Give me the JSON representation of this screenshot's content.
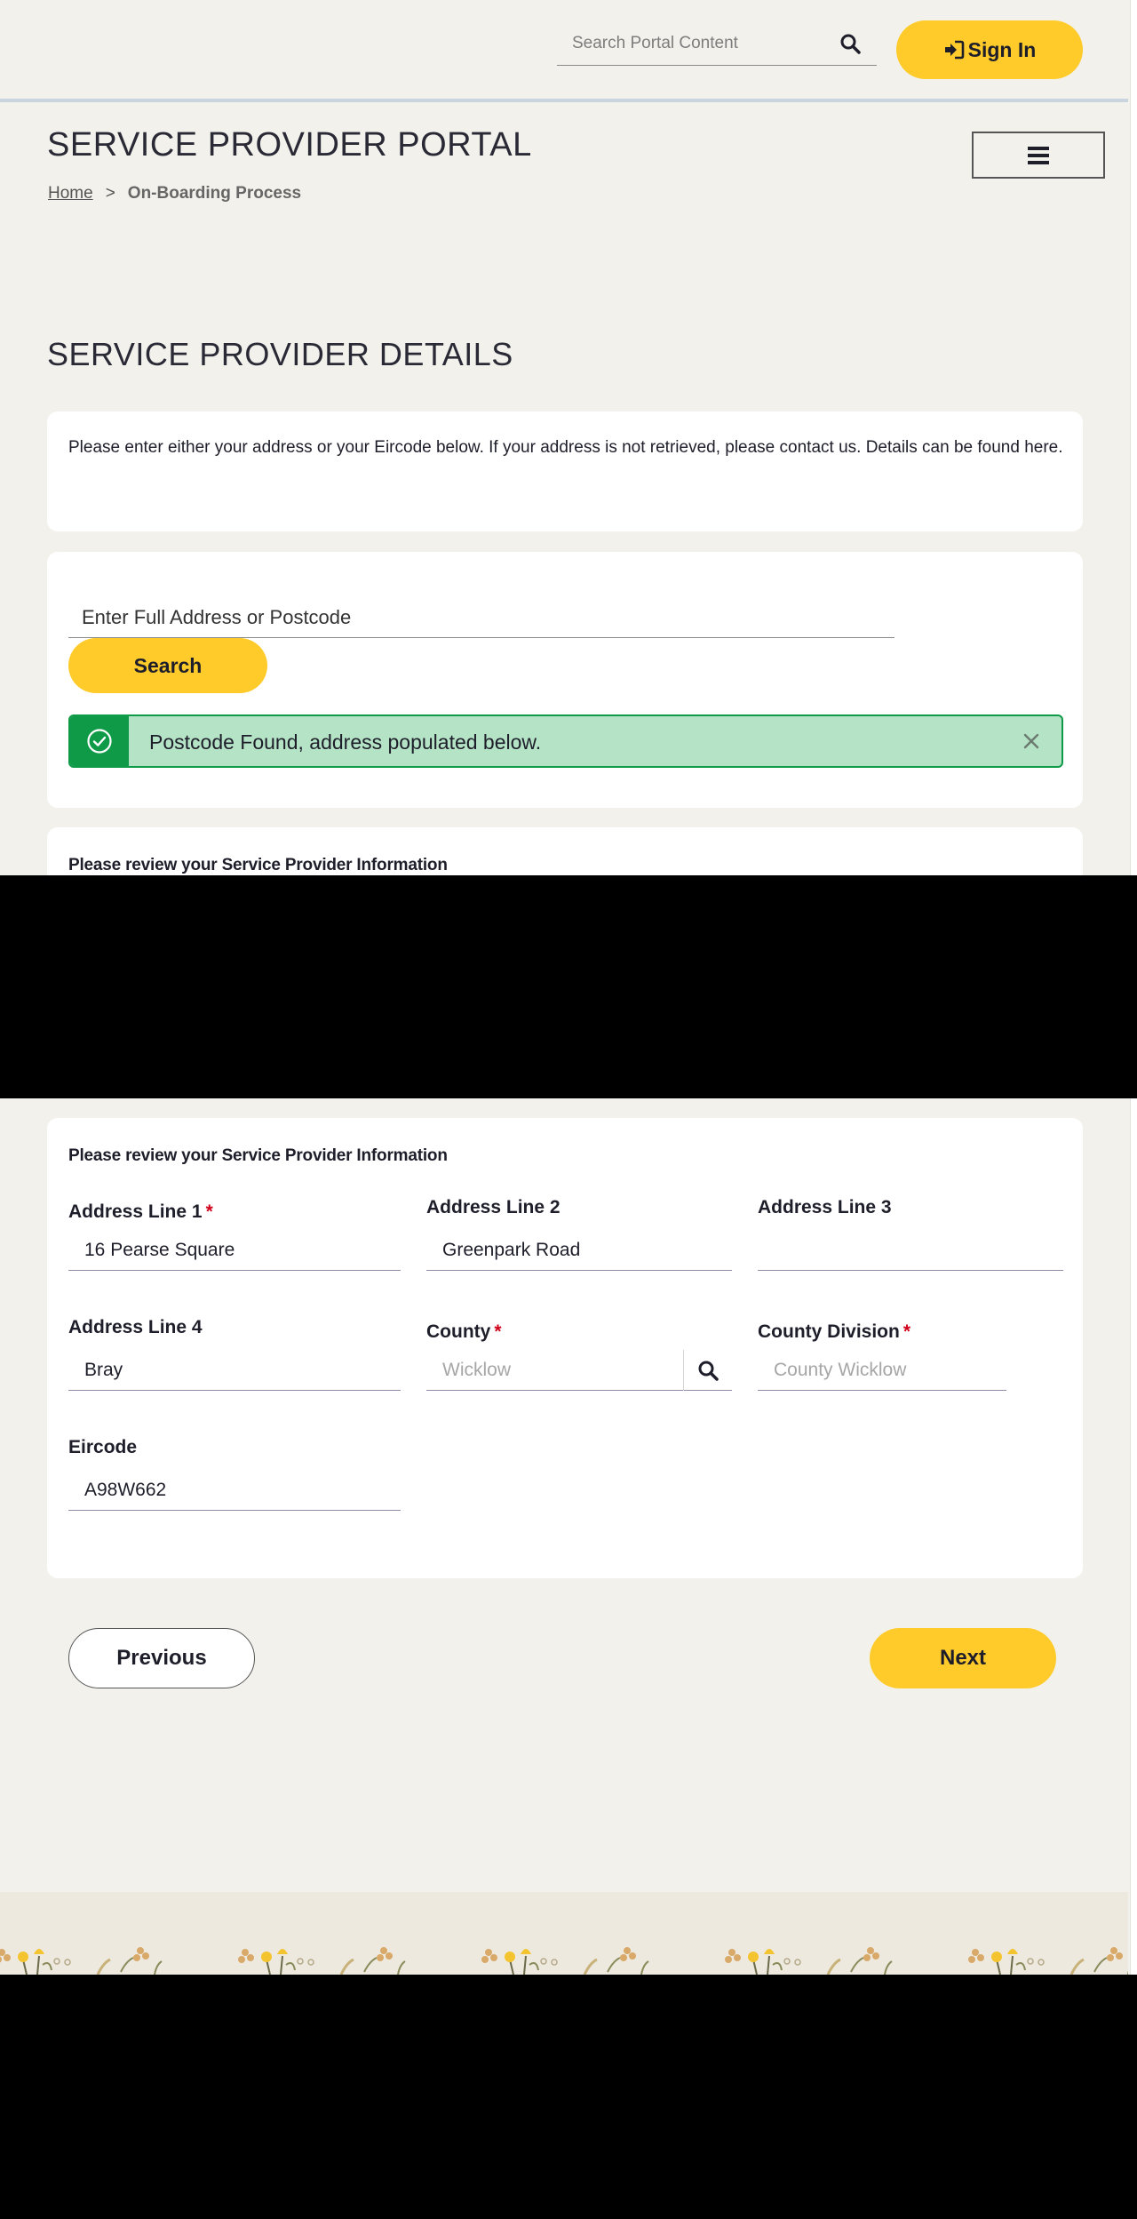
{
  "header": {
    "search_placeholder": "Search Portal Content",
    "sign_in_label": "Sign In"
  },
  "portal": {
    "title": "SERVICE PROVIDER PORTAL"
  },
  "breadcrumb": {
    "home": "Home",
    "separator": ">",
    "current": "On-Boarding Process"
  },
  "page": {
    "section_title": "SERVICE PROVIDER DETAILS",
    "info_text": "Please enter either your address or your Eircode below. If your address is not retrieved, please contact us. Details can be found here."
  },
  "address_search": {
    "placeholder": "Enter Full Address or Postcode",
    "search_label": "Search"
  },
  "alert": {
    "message": "Postcode Found, address populated below.",
    "close_symbol": "×"
  },
  "review": {
    "heading": "Please review your Service Provider Information",
    "required_marker": "*",
    "fields": {
      "address_line_1": {
        "label": "Address Line 1",
        "value": "16 Pearse Square"
      },
      "address_line_2": {
        "label": "Address Line 2",
        "value": "Greenpark Road"
      },
      "address_line_3": {
        "label": "Address Line 3",
        "value": ""
      },
      "address_line_4": {
        "label": "Address Line 4",
        "value": "Bray"
      },
      "county": {
        "label": "County",
        "placeholder": "Wicklow"
      },
      "county_division": {
        "label": "County Division",
        "placeholder": "County Wicklow"
      },
      "eircode": {
        "label": "Eircode",
        "value": "A98W662"
      }
    }
  },
  "navigation": {
    "previous_label": "Previous",
    "next_label": "Next"
  },
  "colors": {
    "accent": "#fecb2a",
    "success": "#0f9a48",
    "success_bg": "#b4e3c6",
    "required": "#d0021b",
    "page_bg": "#f3f1eb"
  },
  "icons": {
    "search": "search-icon",
    "sign_in": "sign-in-icon",
    "menu": "hamburger-menu-icon",
    "success": "check-circle-icon",
    "close": "close-icon",
    "lookup": "search-icon"
  }
}
